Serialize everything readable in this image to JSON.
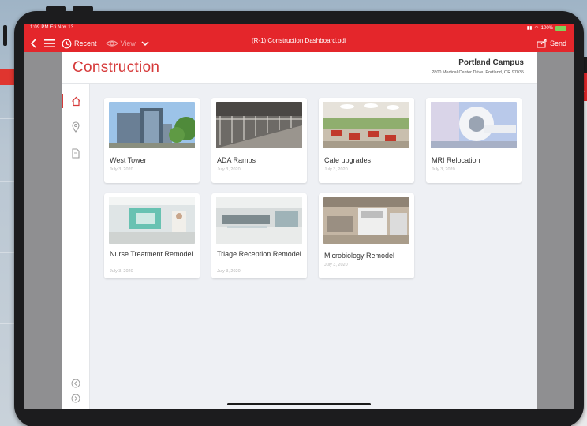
{
  "status": {
    "time_date": "1:09 PM  Fri Nov 13",
    "battery": "100%"
  },
  "toolbar": {
    "recent_label": "Recent",
    "view_label": "View",
    "doc_title": "(R-1) Construction Dashboard.pdf",
    "send_label": "Send"
  },
  "header": {
    "title": "Construction",
    "campus": "Portland Campus",
    "address": "2800 Medical Center Drive, Portland, OR 97035"
  },
  "sidebar": {
    "items": [
      {
        "icon": "home-icon",
        "active": true
      },
      {
        "icon": "location-pin-icon",
        "active": false
      },
      {
        "icon": "document-icon",
        "active": false
      }
    ],
    "bottom": [
      {
        "icon": "chevron-left-circle-icon"
      },
      {
        "icon": "chevron-right-circle-icon"
      }
    ]
  },
  "projects": [
    {
      "name": "West Tower",
      "date": "July 3, 2020"
    },
    {
      "name": "ADA Ramps",
      "date": "July 3, 2020"
    },
    {
      "name": "Cafe upgrades",
      "date": "July 3, 2020"
    },
    {
      "name": "MRI Relocation",
      "date": "July 3, 2020"
    },
    {
      "name": "Nurse Treatment Remodel",
      "date": "July 3, 2020"
    },
    {
      "name": "Triage Reception Remodel",
      "date": "July 3, 2020"
    },
    {
      "name": "Microbiology Remodel",
      "date": "July 3, 2020"
    }
  ],
  "colors": {
    "accent": "#e4262b",
    "title_red": "#d63a3a"
  }
}
